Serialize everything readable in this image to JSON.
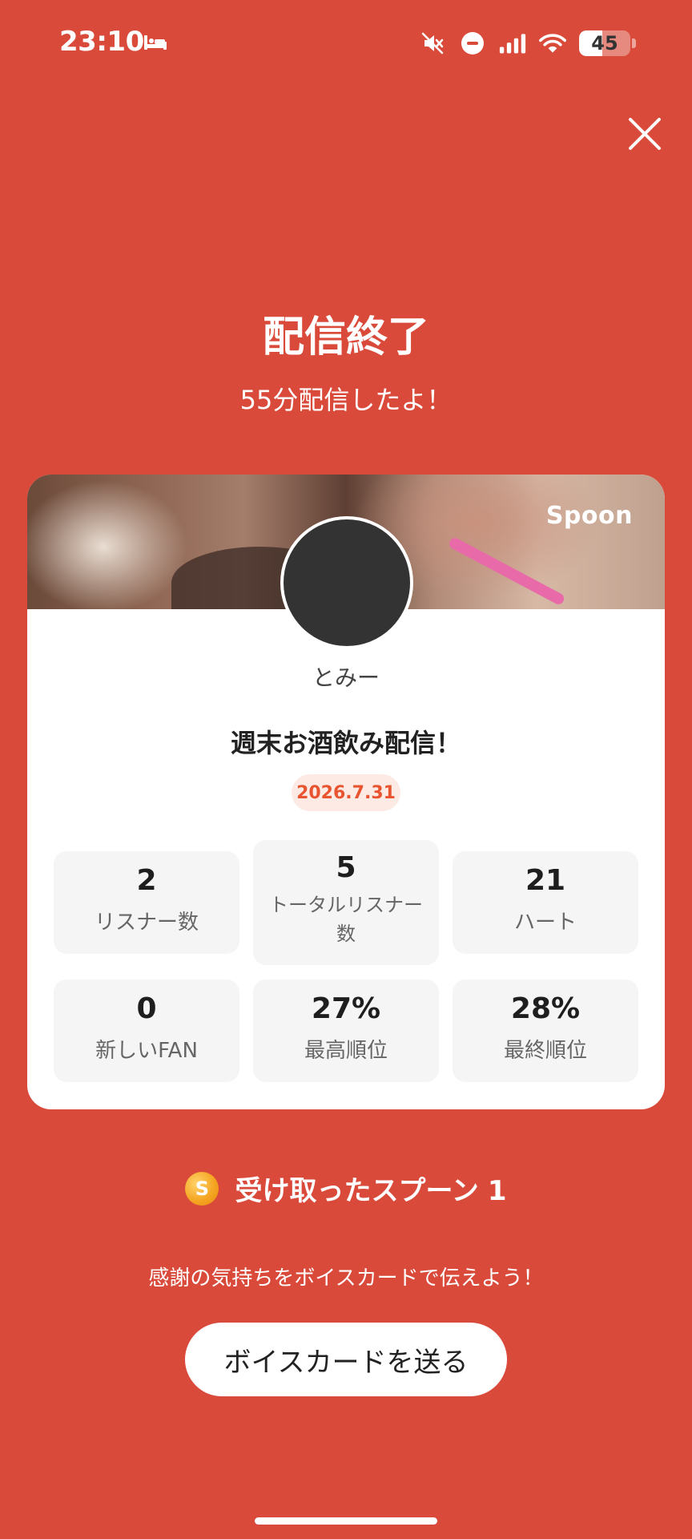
{
  "status_bar": {
    "time": "23:10",
    "battery_level": "45",
    "icons": [
      "bed-icon",
      "mute-icon",
      "do-not-disturb-icon",
      "signal-icon",
      "wifi-icon",
      "battery-icon"
    ]
  },
  "colors": {
    "background": "#d94a3a",
    "card": "#ffffff",
    "badge_text": "#e8542f",
    "badge_bg": "#fdeae4",
    "stat_bg": "#f5f5f5"
  },
  "header": {
    "title": "配信終了",
    "subtitle": "55分配信したよ！"
  },
  "card": {
    "brand": "Spoon",
    "username": "とみー",
    "live_title": "週末お酒飲み配信！",
    "date": "2026.7.31",
    "stats": [
      {
        "value": "2",
        "label": "リスナー数"
      },
      {
        "value": "5",
        "label": "トータルリスナー数"
      },
      {
        "value": "21",
        "label": "ハート"
      },
      {
        "value": "0",
        "label": "新しいFAN"
      },
      {
        "value": "27%",
        "label": "最高順位"
      },
      {
        "value": "28%",
        "label": "最終順位"
      }
    ]
  },
  "spoons": {
    "coin_letter": "S",
    "label": "受け取ったスプーン",
    "count": "1"
  },
  "footer": {
    "thanks_text": "感謝の気持ちをボイスカードで伝えよう！",
    "voice_card_button": "ボイスカードを送る"
  }
}
